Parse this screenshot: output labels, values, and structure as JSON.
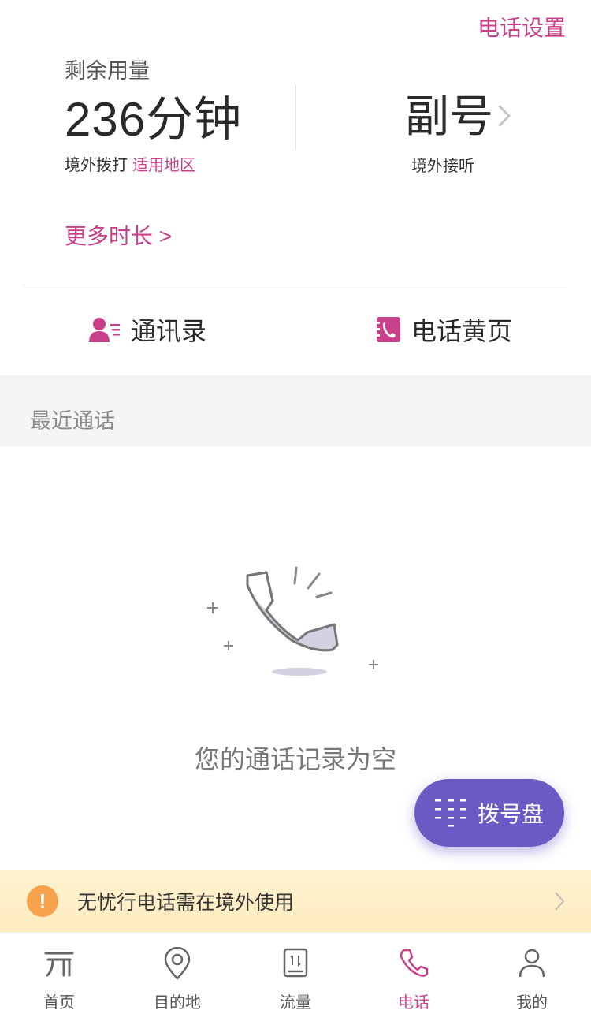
{
  "header": {
    "settings_label": "电话设置"
  },
  "usage": {
    "label": "剩余用量",
    "value": "236分钟",
    "sub_label": "境外拨打",
    "sub_link": "适用地区",
    "secondary_title": "副号",
    "secondary_sub": "境外接听"
  },
  "more_time_label": "更多时长 >",
  "quick_actions": [
    {
      "label": "通讯录",
      "icon": "contacts-icon"
    },
    {
      "label": "电话黄页",
      "icon": "yellow-pages-icon"
    }
  ],
  "recent": {
    "title": "最近通话",
    "empty_text": "您的通话记录为空"
  },
  "dialpad_label": "拨号盘",
  "notice": {
    "text": "无忧行电话需在境外使用"
  },
  "tabs": [
    {
      "label": "首页",
      "icon": "home-icon",
      "active": false
    },
    {
      "label": "目的地",
      "icon": "location-pin-icon",
      "active": false
    },
    {
      "label": "流量",
      "icon": "data-icon",
      "active": false
    },
    {
      "label": "电话",
      "icon": "phone-icon",
      "active": true
    },
    {
      "label": "我的",
      "icon": "user-icon",
      "active": false
    }
  ],
  "colors": {
    "accent": "#c8408a",
    "dialpad": "#6a5ac4",
    "notice_bg": "#fff2cf",
    "notice_icon": "#f6a24c"
  }
}
